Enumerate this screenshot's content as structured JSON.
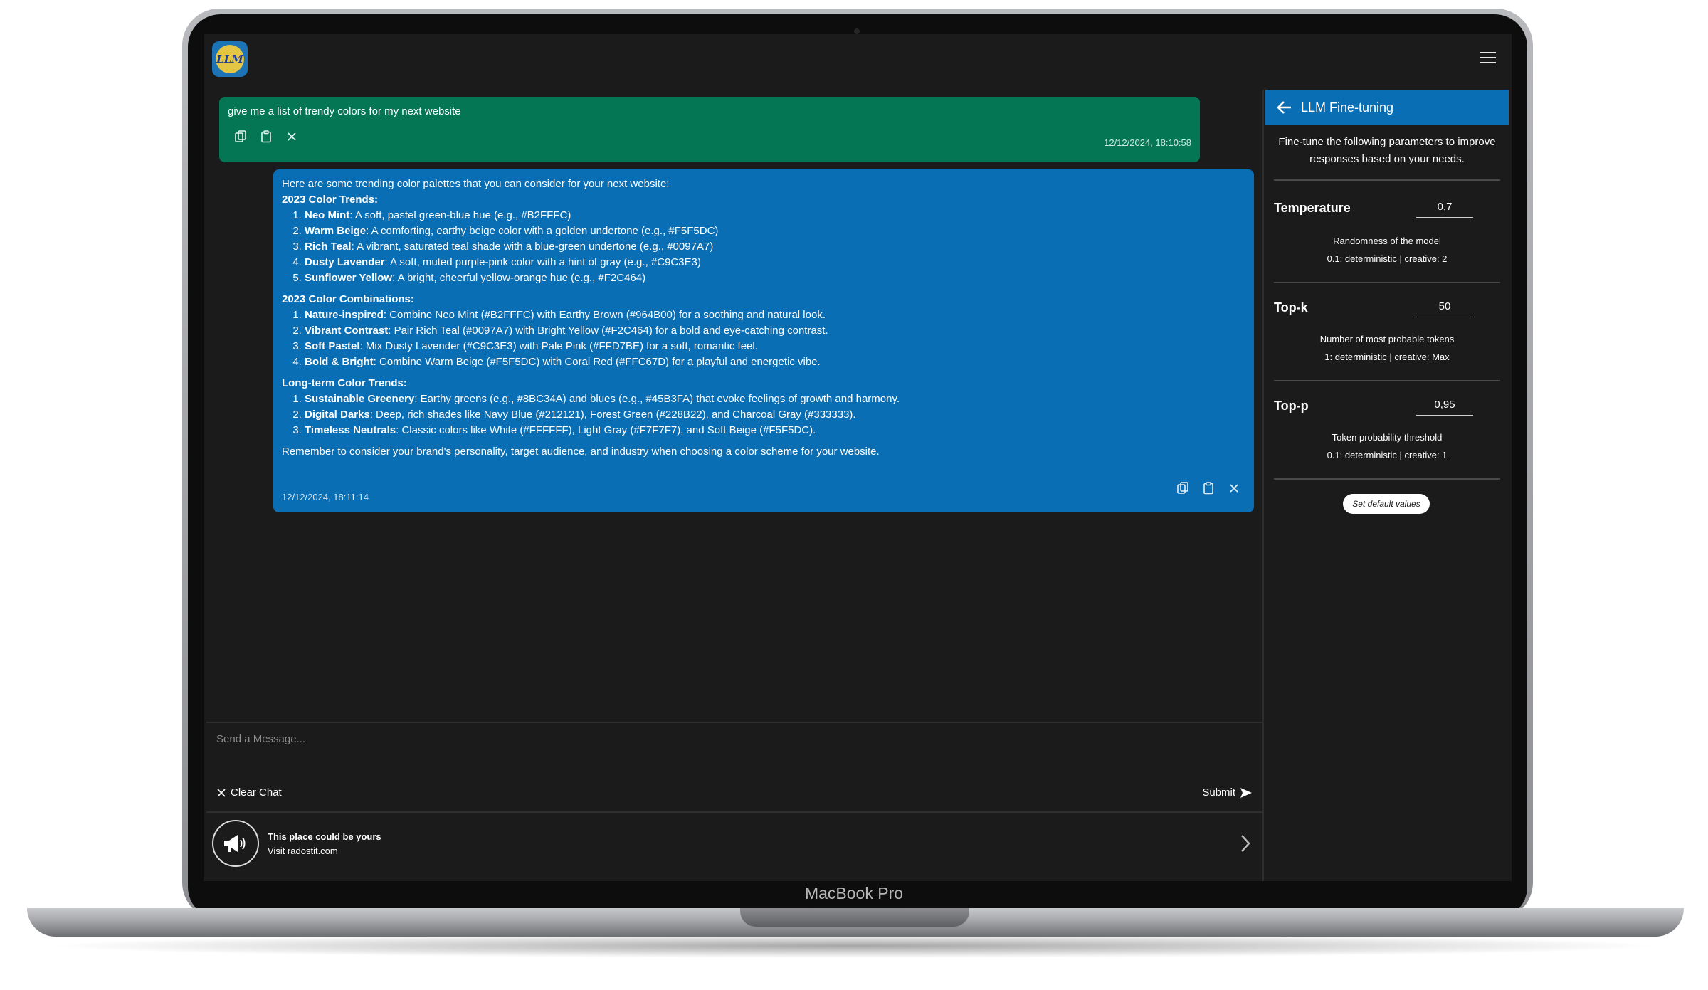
{
  "device": {
    "brand_label": "MacBook Pro"
  },
  "app": {
    "logo_text": "LLM"
  },
  "chat": {
    "user_message": {
      "text": "give me a list of trendy colors for my next website",
      "timestamp": "12/12/2024, 18:10:58"
    },
    "bot_message": {
      "intro": "Here are some trending color palettes that you can consider for your next website:",
      "sections": [
        {
          "heading": "2023 Color Trends:",
          "items": [
            {
              "bold": "Neo Mint",
              "text": ": A soft, pastel green-blue hue (e.g., #B2FFFC)"
            },
            {
              "bold": "Warm Beige",
              "text": ": A comforting, earthy beige color with a golden undertone (e.g., #F5F5DC)"
            },
            {
              "bold": "Rich Teal",
              "text": ": A vibrant, saturated teal shade with a blue-green undertone (e.g., #0097A7)"
            },
            {
              "bold": "Dusty Lavender",
              "text": ": A soft, muted purple-pink color with a hint of gray (e.g., #C9C3E3)"
            },
            {
              "bold": "Sunflower Yellow",
              "text": ": A bright, cheerful yellow-orange hue (e.g., #F2C464)"
            }
          ]
        },
        {
          "heading": "2023 Color Combinations:",
          "items": [
            {
              "bold": "Nature-inspired",
              "text": ": Combine Neo Mint (#B2FFFC) with Earthy Brown (#964B00) for a soothing and natural look."
            },
            {
              "bold": "Vibrant Contrast",
              "text": ": Pair Rich Teal (#0097A7) with Bright Yellow (#F2C464) for a bold and eye-catching contrast."
            },
            {
              "bold": "Soft Pastel",
              "text": ": Mix Dusty Lavender (#C9C3E3) with Pale Pink (#FFD7BE) for a soft, romantic feel."
            },
            {
              "bold": "Bold & Bright",
              "text": ": Combine Warm Beige (#F5F5DC) with Coral Red (#FFC67D) for a playful and energetic vibe."
            }
          ]
        },
        {
          "heading": "Long-term Color Trends:",
          "items": [
            {
              "bold": "Sustainable Greenery",
              "text": ": Earthy greens (e.g., #8BC34A) and blues (e.g., #45B3FA) that evoke feelings of growth and harmony."
            },
            {
              "bold": "Digital Darks",
              "text": ": Deep, rich shades like Navy Blue (#212121), Forest Green (#228B22), and Charcoal Gray (#333333)."
            },
            {
              "bold": "Timeless Neutrals",
              "text": ": Classic colors like White (#FFFFFF), Light Gray (#F7F7F7), and Soft Beige (#F5F5DC)."
            }
          ]
        }
      ],
      "closing": "Remember to consider your brand's personality, target audience, and industry when choosing a color scheme for your website.",
      "timestamp": "12/12/2024, 18:11:14"
    },
    "input": {
      "placeholder": "Send a Message..."
    },
    "clear_label": "Clear Chat",
    "submit_label": "Submit"
  },
  "ad": {
    "title": "This place could be yours",
    "subtitle": "Visit radostit.com"
  },
  "panel": {
    "title": "LLM Fine-tuning",
    "description": "Fine-tune the following parameters to improve responses based on your needs.",
    "params": [
      {
        "label": "Temperature",
        "value": "0,7",
        "desc1": "Randomness of the model",
        "desc2": "0.1: deterministic | creative: 2"
      },
      {
        "label": "Top-k",
        "value": "50",
        "desc1": "Number of most probable tokens",
        "desc2": "1: deterministic | creative: Max"
      },
      {
        "label": "Top-p",
        "value": "0,95",
        "desc1": "Token probability threshold",
        "desc2": "0.1: deterministic | creative: 1"
      }
    ],
    "default_button": "Set default values"
  },
  "colors": {
    "user_bubble": "#057654",
    "bot_bubble": "#0a6eb5",
    "background": "#1b1b1b",
    "panel_header": "#0a6eb5"
  },
  "icons": [
    "menu-icon",
    "copy-icon",
    "clipboard-icon",
    "close-icon",
    "send-icon",
    "megaphone-icon",
    "chevron-right-icon",
    "back-arrow-icon"
  ]
}
